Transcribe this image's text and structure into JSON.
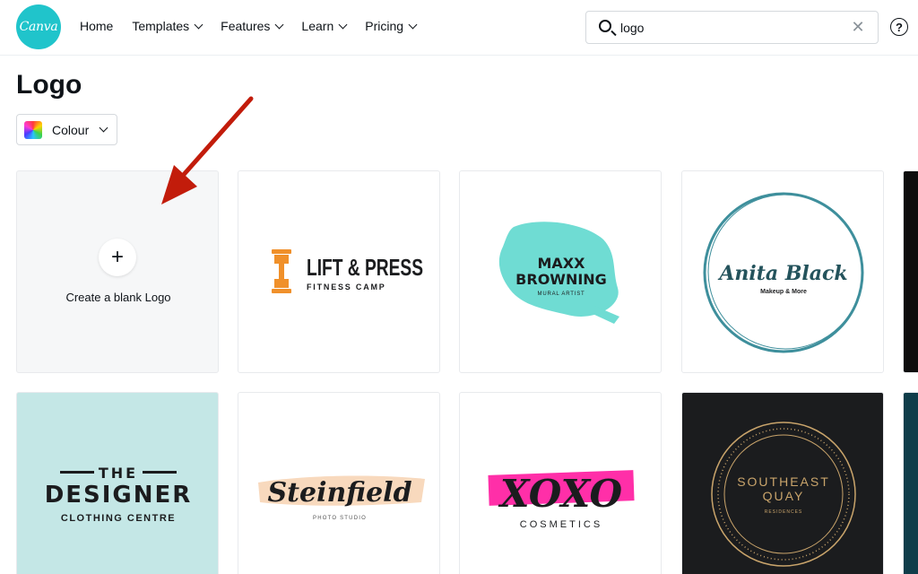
{
  "header": {
    "logo_text": "Canva",
    "nav": [
      {
        "label": "Home",
        "dropdown": false
      },
      {
        "label": "Templates",
        "dropdown": true
      },
      {
        "label": "Features",
        "dropdown": true
      },
      {
        "label": "Learn",
        "dropdown": true
      },
      {
        "label": "Pricing",
        "dropdown": true
      }
    ],
    "search": {
      "value": "logo"
    },
    "help_glyph": "?"
  },
  "page": {
    "title": "Logo",
    "filter_label": "Colour"
  },
  "blank_card": {
    "plus": "+",
    "label": "Create a blank Logo"
  },
  "templates": {
    "lift": {
      "title": "LIFT & PRESS",
      "subtitle": "FITNESS CAMP",
      "accent": "#f0902a"
    },
    "maxx": {
      "title_line1": "MAXX",
      "title_line2": "BROWNING",
      "subtitle": "MURAL ARTIST",
      "accent": "#6fdcd3"
    },
    "anita": {
      "title": "Anita Black",
      "subtitle": "Makeup & More",
      "accent": "#3e8f9c"
    },
    "designer": {
      "line1": "THE",
      "line2": "DESIGNER",
      "line3": "CLOTHING CENTRE",
      "bg": "#c4e7e6"
    },
    "steinfield": {
      "title": "Steinfield",
      "subtitle": "PHOTO STUDIO",
      "accent": "#f8d9bd"
    },
    "xoxo": {
      "title": "XOXO",
      "subtitle": "COSMETICS",
      "accent": "#ff2fa8"
    },
    "southeast": {
      "line1": "SOUTHEAST",
      "line2": "QUAY",
      "subtitle": "RESIDENCES",
      "bg": "#1b1c1e",
      "accent": "#c9a46b"
    }
  },
  "colors": {
    "brand": "#20c4cb",
    "arrow": "#c21c0b"
  }
}
